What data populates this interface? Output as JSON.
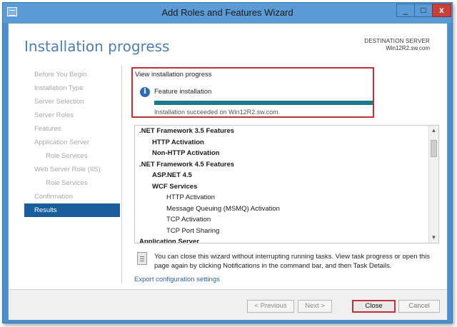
{
  "window": {
    "title": "Add Roles and Features Wizard",
    "controls": {
      "minimize": "_",
      "maximize": "□",
      "close": "x"
    }
  },
  "header": {
    "page_title": "Installation progress",
    "destination_label": "DESTINATION SERVER",
    "destination_value": "Win12R2.sw.com"
  },
  "sidebar": {
    "items": [
      {
        "label": "Before You Begin",
        "level": 0,
        "active": false
      },
      {
        "label": "Installation Type",
        "level": 0,
        "active": false
      },
      {
        "label": "Server Selection",
        "level": 0,
        "active": false
      },
      {
        "label": "Server Roles",
        "level": 0,
        "active": false
      },
      {
        "label": "Features",
        "level": 0,
        "active": false
      },
      {
        "label": "Application Server",
        "level": 0,
        "active": false
      },
      {
        "label": "Role Services",
        "level": 1,
        "active": false
      },
      {
        "label": "Web Server Role (IIS)",
        "level": 0,
        "active": false
      },
      {
        "label": "Role Services",
        "level": 1,
        "active": false
      },
      {
        "label": "Confirmation",
        "level": 0,
        "active": false
      },
      {
        "label": "Results",
        "level": 0,
        "active": true
      }
    ]
  },
  "progress": {
    "heading": "View installation progress",
    "feature_label": "Feature installation",
    "percent": 100,
    "status": "Installation succeeded on Win12R2.sw.com.",
    "bar_color": "#1c7a8c"
  },
  "features_list": [
    {
      "label": ".NET Framework 3.5 Features",
      "level": 0
    },
    {
      "label": "HTTP Activation",
      "level": 1
    },
    {
      "label": "Non-HTTP Activation",
      "level": 1
    },
    {
      "label": ".NET Framework 4.5 Features",
      "level": 0
    },
    {
      "label": "ASP.NET 4.5",
      "level": 1
    },
    {
      "label": "WCF Services",
      "level": 1
    },
    {
      "label": "HTTP Activation",
      "level": 2
    },
    {
      "label": "Message Queuing (MSMQ) Activation",
      "level": 2
    },
    {
      "label": "TCP Activation",
      "level": 2
    },
    {
      "label": "TCP Port Sharing",
      "level": 2
    },
    {
      "label": "Application Server",
      "level": 0
    }
  ],
  "note": "You can close this wizard without interrupting running tasks. View task progress or open this page again by clicking Notifications in the command bar, and then Task Details.",
  "export_link": "Export configuration settings",
  "buttons": {
    "previous": "< Previous",
    "next": "Next >",
    "close": "Close",
    "cancel": "Cancel"
  },
  "colors": {
    "accent": "#1a5d9c",
    "highlight_border": "#c0303a",
    "title_blue": "#4f7fae"
  }
}
